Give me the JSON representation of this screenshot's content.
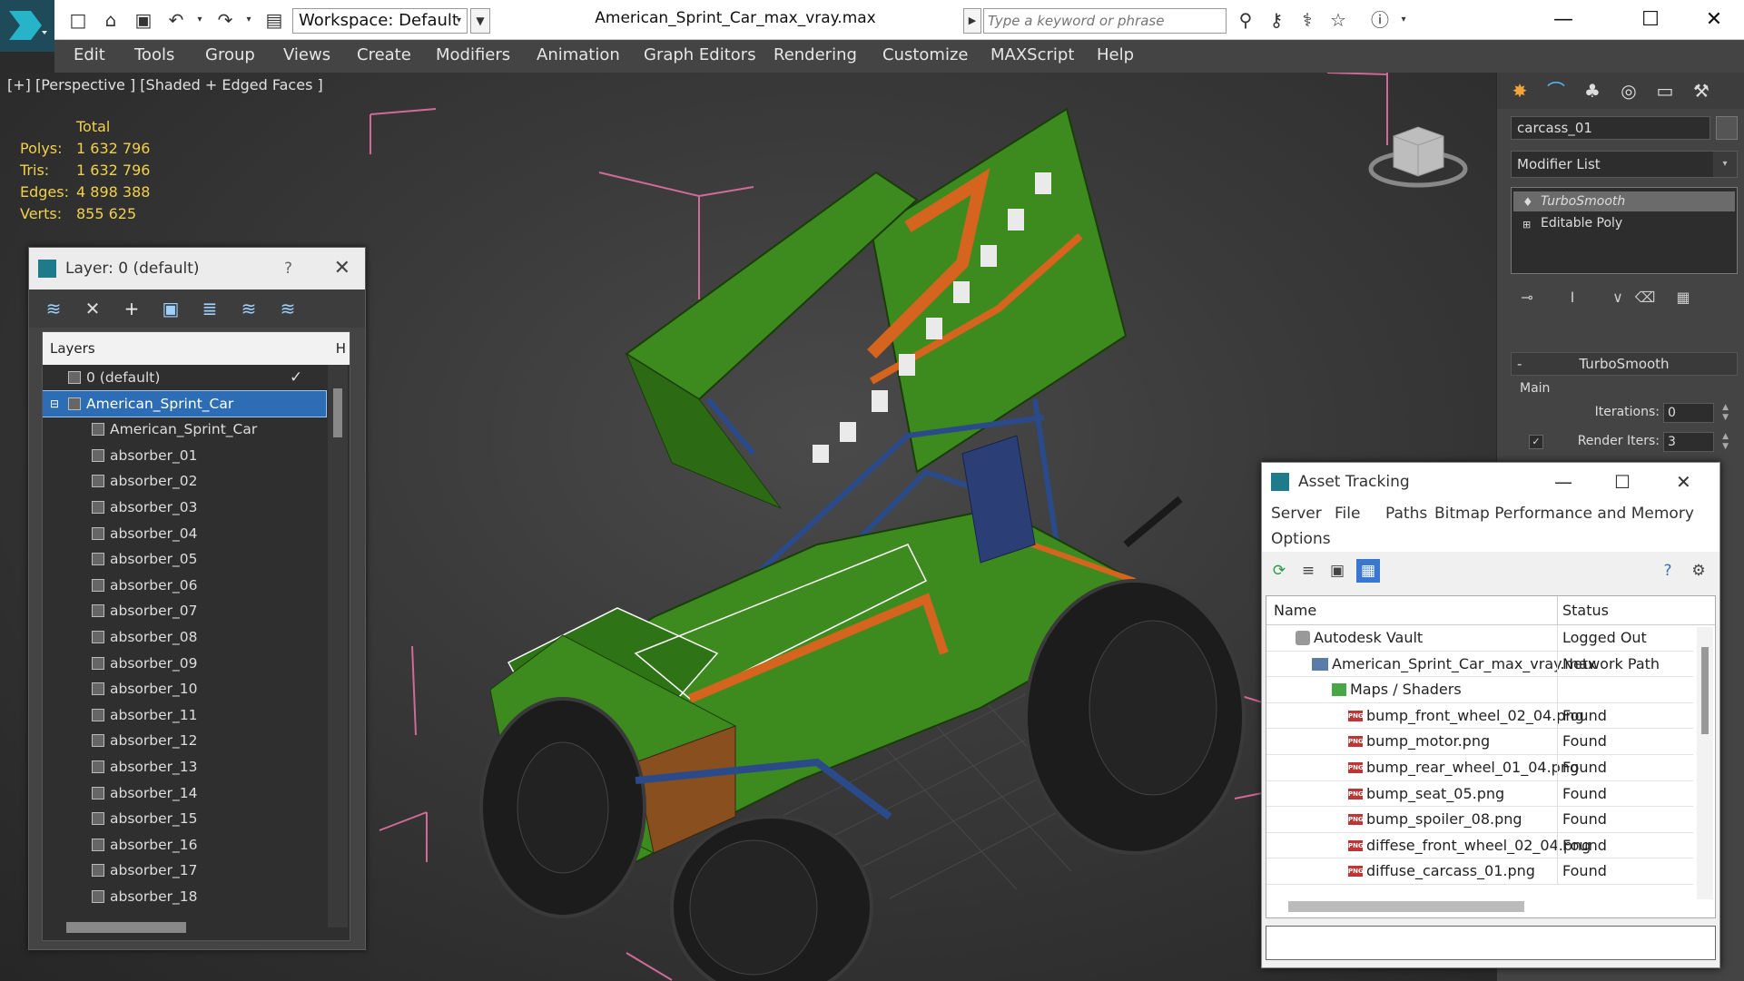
{
  "titlebar": {
    "workspace_label": "Workspace: Default",
    "document_title": "American_Sprint_Car_max_vray.max",
    "search_placeholder": "Type a keyword or phrase"
  },
  "menubar": {
    "items": [
      "Edit",
      "Tools",
      "Group",
      "Views",
      "Create",
      "Modifiers",
      "Animation",
      "Graph Editors",
      "Rendering",
      "Customize",
      "MAXScript",
      "Help"
    ]
  },
  "viewport": {
    "label": "[+] [Perspective ] [Shaded + Edged Faces ]",
    "stats": {
      "header": "Total",
      "rows": [
        {
          "key": "Polys:",
          "value": "1 632 796"
        },
        {
          "key": "Tris:",
          "value": "1 632 796"
        },
        {
          "key": "Edges:",
          "value": "4 898 388"
        },
        {
          "key": "Verts:",
          "value": "855 625"
        }
      ]
    }
  },
  "layer_dialog": {
    "title": "Layer: 0 (default)",
    "help": "?",
    "column_header": "Layers",
    "column_header_2": "H",
    "rows": [
      {
        "label": "0 (default)",
        "indent": 1
      },
      {
        "label": "American_Sprint_Car",
        "indent": 1,
        "selected": true
      },
      {
        "label": "American_Sprint_Car",
        "indent": 2
      },
      {
        "label": "absorber_01",
        "indent": 2
      },
      {
        "label": "absorber_02",
        "indent": 2
      },
      {
        "label": "absorber_03",
        "indent": 2
      },
      {
        "label": "absorber_04",
        "indent": 2
      },
      {
        "label": "absorber_05",
        "indent": 2
      },
      {
        "label": "absorber_06",
        "indent": 2
      },
      {
        "label": "absorber_07",
        "indent": 2
      },
      {
        "label": "absorber_08",
        "indent": 2
      },
      {
        "label": "absorber_09",
        "indent": 2
      },
      {
        "label": "absorber_10",
        "indent": 2
      },
      {
        "label": "absorber_11",
        "indent": 2
      },
      {
        "label": "absorber_12",
        "indent": 2
      },
      {
        "label": "absorber_13",
        "indent": 2
      },
      {
        "label": "absorber_14",
        "indent": 2
      },
      {
        "label": "absorber_15",
        "indent": 2
      },
      {
        "label": "absorber_16",
        "indent": 2
      },
      {
        "label": "absorber_17",
        "indent": 2
      },
      {
        "label": "absorber_18",
        "indent": 2
      }
    ]
  },
  "command_panel": {
    "object_name": "carcass_01",
    "modifier_list_label": "Modifier List",
    "stack": [
      "TurboSmooth",
      "Editable Poly"
    ],
    "rollout_title": "TurboSmooth",
    "group_label": "Main",
    "iterations_label": "Iterations:",
    "iterations_value": "0",
    "render_iters_label": "Render Iters:",
    "render_iters_value": "3",
    "render_iters_checked": true
  },
  "asset_tracking": {
    "title": "Asset Tracking",
    "menu": [
      "Server",
      "File",
      "Paths",
      "Bitmap Performance and Memory",
      "Options"
    ],
    "columns": [
      "Name",
      "Status"
    ],
    "rows": [
      {
        "name": "Autodesk Vault",
        "status": "Logged Out",
        "icon": "vault-icon",
        "indent": 1
      },
      {
        "name": "American_Sprint_Car_max_vray.max",
        "status": "Network Path",
        "icon": "max-file-icon",
        "indent": 2
      },
      {
        "name": "Maps / Shaders",
        "status": "",
        "icon": "maps-folder-icon",
        "indent": 3
      },
      {
        "name": "bump_front_wheel_02_04.png",
        "status": "Found",
        "icon": "png-file-icon",
        "indent": 4
      },
      {
        "name": "bump_motor.png",
        "status": "Found",
        "icon": "png-file-icon",
        "indent": 4
      },
      {
        "name": "bump_rear_wheel_01_04.png",
        "status": "Found",
        "icon": "png-file-icon",
        "indent": 4
      },
      {
        "name": "bump_seat_05.png",
        "status": "Found",
        "icon": "png-file-icon",
        "indent": 4
      },
      {
        "name": "bump_spoiler_08.png",
        "status": "Found",
        "icon": "png-file-icon",
        "indent": 4
      },
      {
        "name": "diffese_front_wheel_02_04.png",
        "status": "Found",
        "icon": "png-file-icon",
        "indent": 4
      },
      {
        "name": "diffuse_carcass_01.png",
        "status": "Found",
        "icon": "png-file-icon",
        "indent": 4
      }
    ]
  },
  "colors": {
    "stats_text": "#f1d14a",
    "selection": "#2d6db5",
    "car_body": "#3d8a1f",
    "car_stripe": "#d4641e"
  }
}
